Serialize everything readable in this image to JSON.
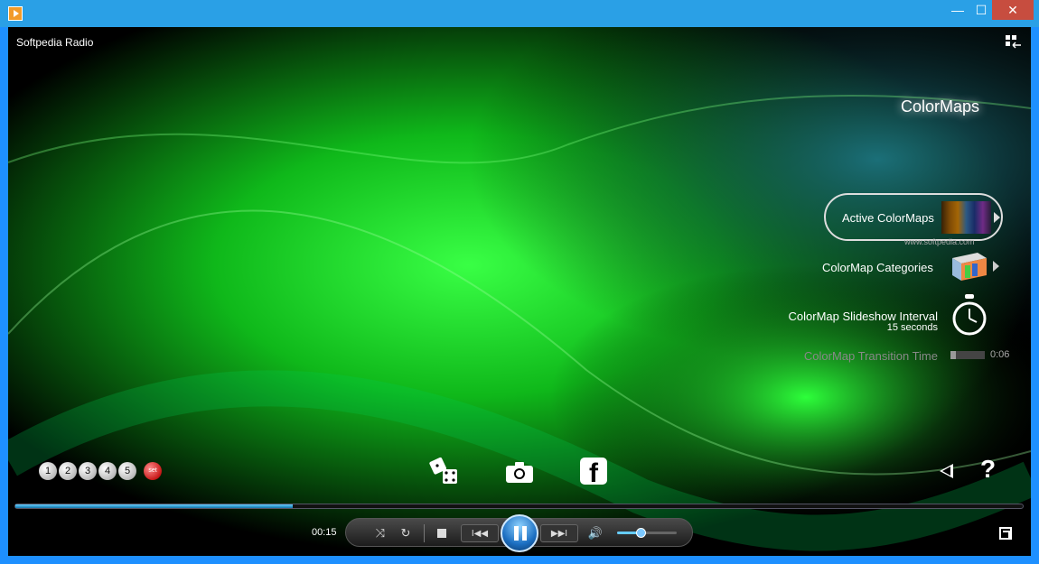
{
  "window": {
    "app_title": "Softpedia Radio",
    "minimize": "—",
    "maximize": "☐",
    "close": "✕"
  },
  "colormaps": {
    "title": "ColorMaps",
    "active_label": "Active ColorMaps",
    "categories_label": "ColorMap Categories",
    "slideshow_label": "ColorMap Slideshow Interval",
    "slideshow_value": "15 seconds",
    "transition_label": "ColorMap Transition Time",
    "transition_value": "0:06",
    "transition_level": 0.16,
    "watermark": "www.softpedia.com"
  },
  "presets": [
    "1",
    "2",
    "3",
    "4",
    "5"
  ],
  "preset_set": "set",
  "player": {
    "time": "00:15",
    "progress": 0.275,
    "volume": 0.4,
    "prev": "I◀◀",
    "next": "▶▶I",
    "shuffle": "⤨",
    "repeat": "↻",
    "volume_icon": "🔊",
    "facebook": "f",
    "help": "?"
  },
  "icons": [
    "app-icon",
    "layout-icon",
    "dice-icon",
    "camera-icon",
    "facebook-icon",
    "back-icon",
    "help-icon",
    "shuffle-icon",
    "repeat-icon",
    "stop-icon",
    "previous-icon",
    "pause-icon",
    "next-icon",
    "volume-icon",
    "mini-view-icon"
  ],
  "colors": {
    "accent": "#2aa0e6",
    "close": "#c74d3f",
    "progress": "#17a",
    "green": "#1dff2a"
  }
}
